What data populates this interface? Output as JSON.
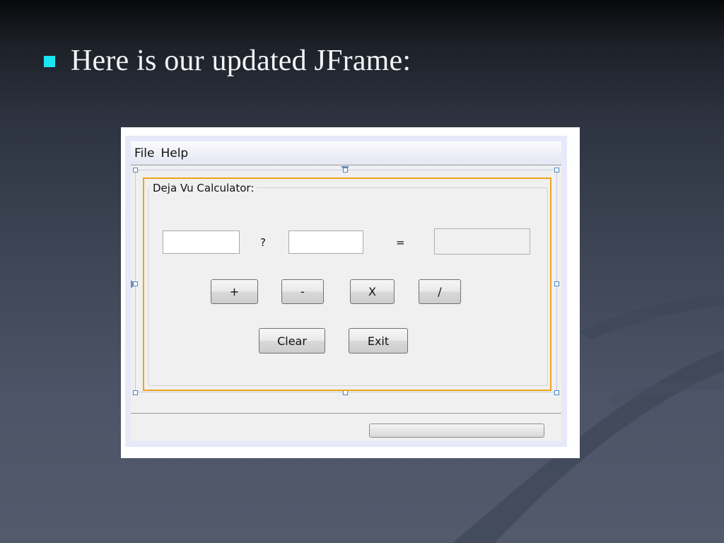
{
  "slide": {
    "bullet_text": "Here is our updated JFrame:"
  },
  "app": {
    "menu": [
      "File",
      "Help"
    ],
    "group_title": "Deja Vu Calculator:",
    "operator_symbol": "?",
    "equals_symbol": "=",
    "operand1_value": "",
    "operand2_value": "",
    "result_value": "",
    "operation_buttons": [
      "+",
      "-",
      "X",
      "/"
    ],
    "clear_label": "Clear",
    "exit_label": "Exit",
    "progress": 0
  },
  "colors": {
    "bullet": "#19e6f2",
    "selection_border": "#f0a31d",
    "handle_border": "#4a84c4"
  }
}
